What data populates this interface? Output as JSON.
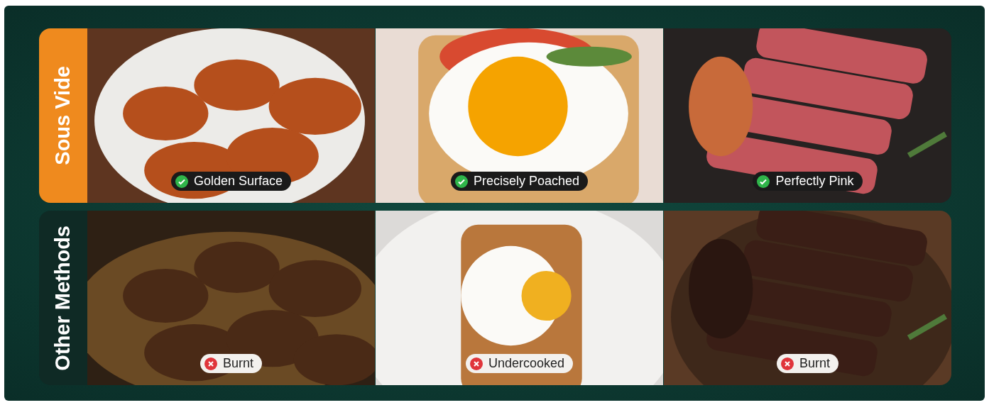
{
  "rows": [
    {
      "label": "Sous Vide",
      "kind": "good",
      "cells": [
        {
          "caption": "Golden Surface"
        },
        {
          "caption": "Precisely Poached"
        },
        {
          "caption": "Perfectly Pink"
        }
      ]
    },
    {
      "label": "Other Methods",
      "kind": "bad",
      "cells": [
        {
          "caption": "Burnt"
        },
        {
          "caption": "Undercooked"
        },
        {
          "caption": "Burnt"
        }
      ]
    }
  ]
}
